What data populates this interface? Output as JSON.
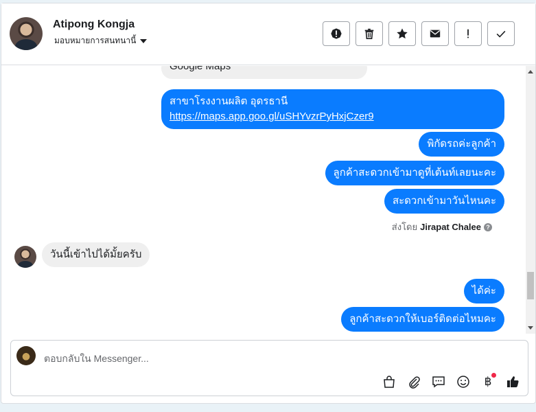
{
  "header": {
    "name": "Atipong Kongja",
    "subtitle": "มอบหมายการสนทนานี้",
    "actions": [
      {
        "name": "spam-button",
        "icon": "alert-circle-icon"
      },
      {
        "name": "delete-button",
        "icon": "trash-icon"
      },
      {
        "name": "star-button",
        "icon": "star-icon"
      },
      {
        "name": "mark-unread-button",
        "icon": "envelope-icon"
      },
      {
        "name": "follow-up-button",
        "icon": "exclamation-icon"
      },
      {
        "name": "mark-done-button",
        "icon": "check-icon"
      }
    ]
  },
  "messages": {
    "m0": "Google Maps",
    "m1_line1": "สาขาโรงงานผลิต อุดรธานี",
    "m1_link": "https://maps.app.goo.gl/uSHYvzrPyHxjCzer9",
    "m2": "พิกัดรถค่ะลูกค้า",
    "m3": "ลูกค้าสะดวกเข้ามาดูที่เต้นท์เลยนะคะ",
    "m4": "สะดวกเข้ามาวันไหนคะ",
    "sent_by_prefix": "ส่งโดย",
    "sent_by_name": "Jirapat Chalee",
    "m5": "วันนี้เข้าไปได้มั้ยครับ",
    "m6": "ได้ค่ะ",
    "m7": "ลูกค้าสะดวกให้เบอร์ติดต่อไหมคะ"
  },
  "composer": {
    "placeholder": "ตอบกลับใน Messenger...",
    "currency_symbol": "฿",
    "tools": [
      "shopping-bag-icon",
      "paperclip-icon",
      "saved-replies-icon",
      "emoji-icon",
      "payment-icon",
      "thumbs-up-icon"
    ]
  },
  "colors": {
    "outgoing_bubble": "#0a7cff",
    "incoming_bubble": "#efefef",
    "notification_dot": "#f02849"
  }
}
